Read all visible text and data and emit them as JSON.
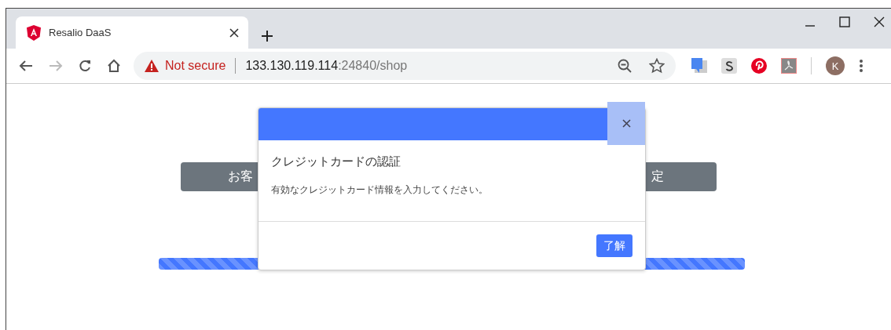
{
  "browser": {
    "tab": {
      "title": "Resalio DaaS"
    },
    "address": {
      "security": "Not secure",
      "host": "133.130.119.114",
      "path": ":24840/shop"
    },
    "profile": "K"
  },
  "page": {
    "buttons": [
      "お客",
      "定"
    ],
    "progress": {
      "level": 1
    }
  },
  "modal": {
    "title": "クレジットカードの認証",
    "message": "有効なクレジットカード情報を入力してください。",
    "confirm": "了解"
  }
}
